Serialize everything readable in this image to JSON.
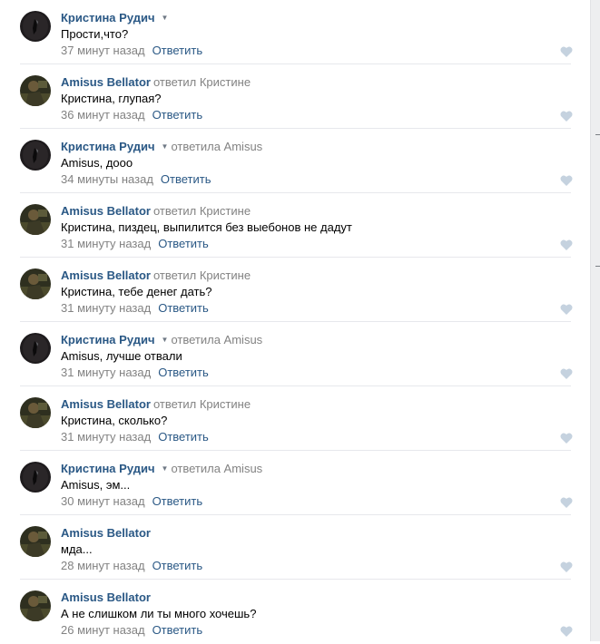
{
  "ui": {
    "reply_label": "Ответить",
    "colors": {
      "link": "#2a5885",
      "meta": "#828282",
      "like": "#c5d2df",
      "divider": "#e7e8ec"
    }
  },
  "comments": [
    {
      "avatar": "avatar-kristina",
      "author": "Кристина Рудич",
      "has_menu": true,
      "reply_to": "",
      "text": "Прости,что?",
      "date": "37 минут назад"
    },
    {
      "avatar": "avatar-amisus",
      "author": "Amisus Bellator",
      "has_menu": false,
      "reply_to": "ответил Кристине",
      "text": "Кристина, глупая?",
      "date": "36 минут назад"
    },
    {
      "avatar": "avatar-kristina",
      "author": "Кристина Рудич",
      "has_menu": true,
      "reply_to": "ответила Amisus",
      "text": "Amisus, дооо",
      "date": "34 минуты назад"
    },
    {
      "avatar": "avatar-amisus",
      "author": "Amisus Bellator",
      "has_menu": false,
      "reply_to": "ответил Кристине",
      "text": "Кристина, пиздец, выпилится без выебонов не дадут",
      "date": "31 минуту назад"
    },
    {
      "avatar": "avatar-amisus",
      "author": "Amisus Bellator",
      "has_menu": false,
      "reply_to": "ответил Кристине",
      "text": "Кристина, тебе денег дать?",
      "date": "31 минуту назад"
    },
    {
      "avatar": "avatar-kristina",
      "author": "Кристина Рудич",
      "has_menu": true,
      "reply_to": "ответила Amisus",
      "text": "Amisus, лучше отвали",
      "date": "31 минуту назад"
    },
    {
      "avatar": "avatar-amisus",
      "author": "Amisus Bellator",
      "has_menu": false,
      "reply_to": "ответил Кристине",
      "text": "Кристина, сколько?",
      "date": "31 минуту назад"
    },
    {
      "avatar": "avatar-kristina",
      "author": "Кристина Рудич",
      "has_menu": true,
      "reply_to": "ответила Amisus",
      "text": "Amisus, эм...",
      "date": "30 минут назад"
    },
    {
      "avatar": "avatar-amisus",
      "author": "Amisus Bellator",
      "has_menu": false,
      "reply_to": "",
      "text": "мда...",
      "date": "28 минут назад"
    },
    {
      "avatar": "avatar-amisus",
      "author": "Amisus Bellator",
      "has_menu": false,
      "reply_to": "",
      "text": "А не слишком ли ты много хочешь?",
      "date": "26 минут назад"
    }
  ]
}
